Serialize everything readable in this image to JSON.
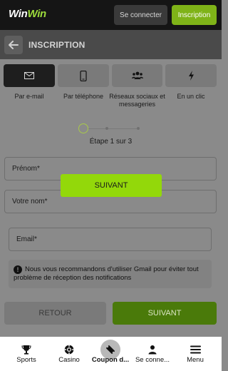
{
  "header": {
    "logo_win1": "Win",
    "logo_win2": "Win",
    "login_label": "Se connecter",
    "register_label": "Inscription"
  },
  "titlebar": {
    "title": "INSCRIPTION"
  },
  "methods": [
    {
      "label": "Par e-mail",
      "icon": "envelope-icon",
      "active": true
    },
    {
      "label": "Par téléphone",
      "icon": "phone-icon",
      "active": false
    },
    {
      "label": "Réseaux sociaux et messageries",
      "icon": "people-icon",
      "active": false
    },
    {
      "label": "En un clic",
      "icon": "lightning-icon",
      "active": false
    }
  ],
  "stepper": {
    "text": "Étape 1 sur 3",
    "current": 1,
    "total": 3
  },
  "form": {
    "first_name_placeholder": "Prénom*",
    "last_name_placeholder": "Votre nom*",
    "email_placeholder": "Email*"
  },
  "notice": {
    "text": "Nous vous recommandons d'utiliser Gmail pour éviter tout problème de réception des notifications"
  },
  "overlay": {
    "next_label": "SUIVANT"
  },
  "actions": {
    "back_label": "RETOUR",
    "next_label": "SUIVANT"
  },
  "bottom_nav": [
    {
      "label": "Sports",
      "icon": "trophy-icon",
      "active": false
    },
    {
      "label": "Casino",
      "icon": "casino-chip-icon",
      "active": false
    },
    {
      "label": "Coupon d...",
      "icon": "ticket-icon",
      "active": true
    },
    {
      "label": "Se conne...",
      "icon": "user-icon",
      "active": false
    },
    {
      "label": "Menu",
      "icon": "hamburger-icon",
      "active": false
    }
  ],
  "colors": {
    "brand_green": "#7fb318",
    "bright_green": "#93d80a",
    "dark_green": "#4a7a0a"
  }
}
